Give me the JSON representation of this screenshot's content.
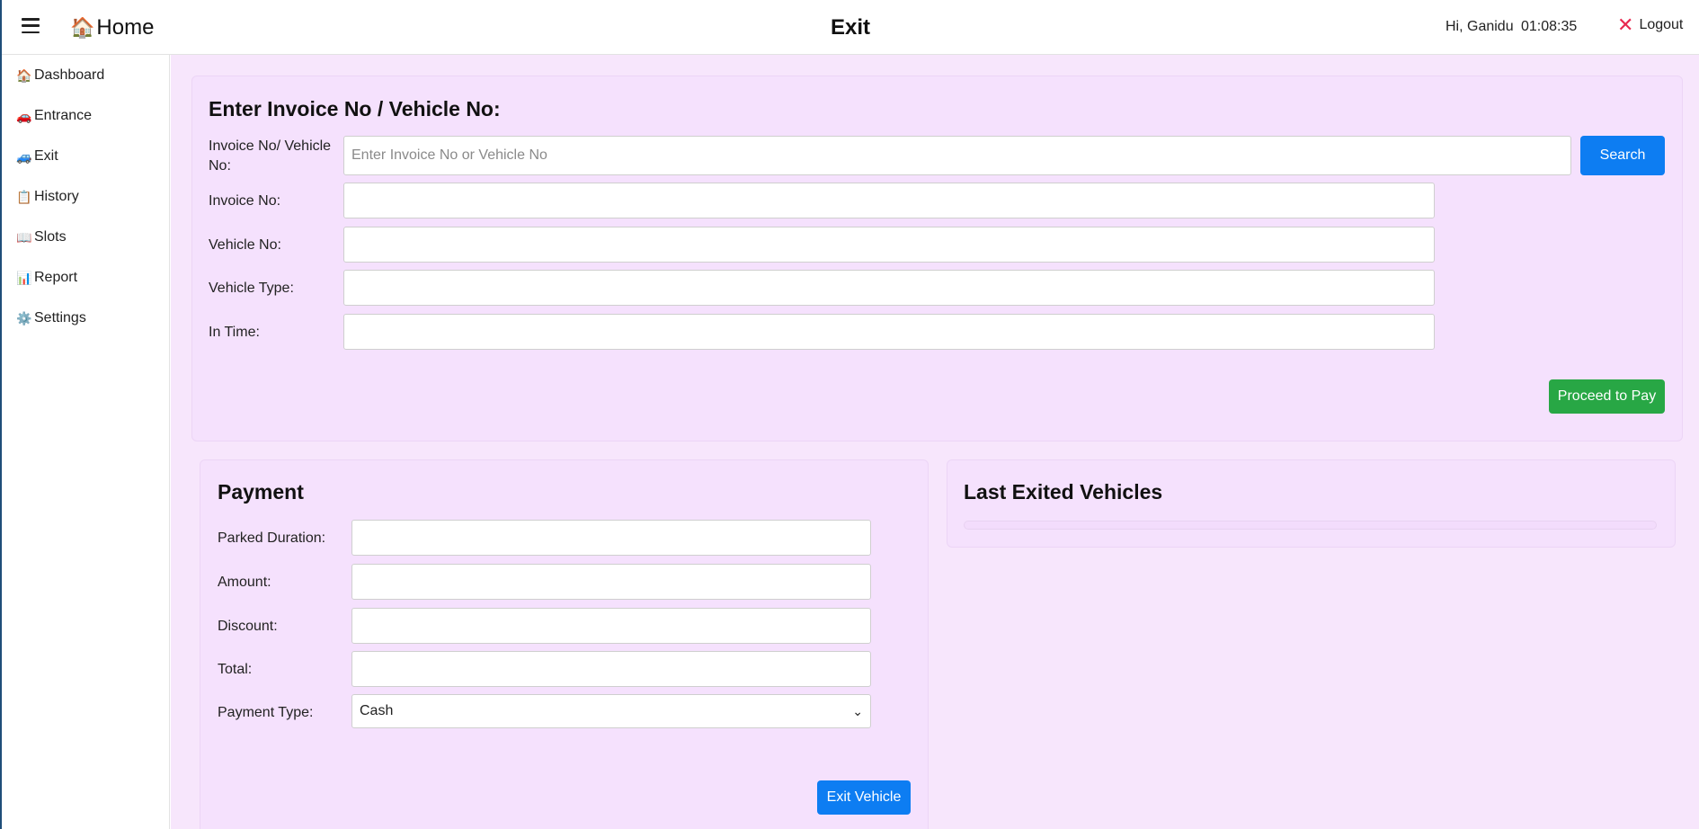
{
  "header": {
    "home_label": "Home",
    "page_title": "Exit",
    "greeting": "Hi, Ganidu",
    "clock": "01:08:35",
    "logout_label": "Logout"
  },
  "sidebar": {
    "items": [
      {
        "icon": "🏠",
        "label": "Dashboard"
      },
      {
        "icon": "🚗",
        "label": "Entrance"
      },
      {
        "icon": "🚙",
        "label": "Exit"
      },
      {
        "icon": "📋",
        "label": "History"
      },
      {
        "icon": "📖",
        "label": "Slots"
      },
      {
        "icon": "📊",
        "label": "Report"
      },
      {
        "icon": "⚙️",
        "label": "Settings"
      }
    ]
  },
  "search_card": {
    "title": "Enter Invoice No / Vehicle No:",
    "search_label_line1": "Invoice No/ Vehicle",
    "search_label_line2": "No:",
    "search_placeholder": "Enter Invoice No or Vehicle No",
    "search_button": "Search",
    "invoice_label": "Invoice No:",
    "invoice_value": "",
    "vehicle_label": "Vehicle No:",
    "vehicle_value": "",
    "vehicle_type_label": "Vehicle Type:",
    "vehicle_type_value": "",
    "in_time_label": "In Time:",
    "in_time_value": "",
    "proceed_button": "Proceed to Pay"
  },
  "payment_card": {
    "title": "Payment",
    "duration_label": "Parked Duration:",
    "duration_value": "",
    "amount_label": "Amount:",
    "amount_value": "",
    "discount_label": "Discount:",
    "discount_value": "",
    "total_label": "Total:",
    "total_value": "",
    "payment_type_label": "Payment Type:",
    "payment_type_value": "Cash",
    "exit_button": "Exit Vehicle"
  },
  "last_exited_card": {
    "title": "Last Exited Vehicles"
  },
  "colors": {
    "primary": "#0d7df2",
    "success": "#28a745",
    "main_bg": "#f7e6fc",
    "logout_x": "#e8284f"
  }
}
